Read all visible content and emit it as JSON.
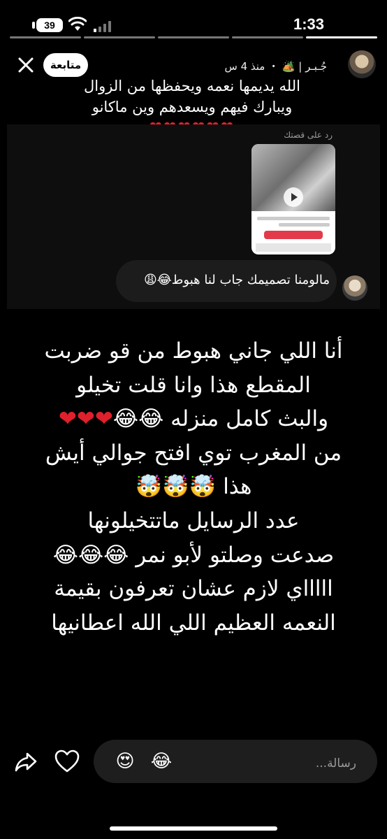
{
  "status": {
    "time": "1:33",
    "battery": "39"
  },
  "story": {
    "segments": 5,
    "active_segment": 1
  },
  "header": {
    "username": "جُـبـر | 🏕️ ・ منذ 4 س",
    "follow_label": "متابعة"
  },
  "caption": {
    "line1": "الله يديمها نعمه ويحفظها من الزوال",
    "line2": "ويبارك فيهم ويسعدهم وين ماكانو",
    "hearts": "❤❤❤❤❤❤"
  },
  "reply": {
    "label": "رد على قصتك",
    "message": "مالومنا تصميمك جاب لنا هبوط😂😩"
  },
  "main_text": {
    "line1": "أنا اللي جاني هبوط من قو ضربت",
    "line2": "المقطع هذا وانا قلت تخيلو",
    "line3_text": "والبث كامل منزله 😂😂",
    "line3_hearts": "❤❤❤",
    "line4": "من المغرب توي افتح جوالي أيش",
    "line5": "هذا 🤯🤯🤯",
    "line6": "عدد الرسايل ماتتخيلونها",
    "line7": "صدعت وصلتو لأبو نمر 😂😂😂",
    "line8": "اااااي لازم عشان تعرفون بقيمة",
    "line9": "النعمه العظيم اللي الله اعطانيها"
  },
  "bottom": {
    "placeholder": "رسالة...",
    "emoji1": "😍",
    "emoji2": "😂"
  },
  "icons": [
    "close-icon",
    "share-icon",
    "heart-icon",
    "wifi-icon",
    "signal-icon",
    "battery-icon"
  ]
}
